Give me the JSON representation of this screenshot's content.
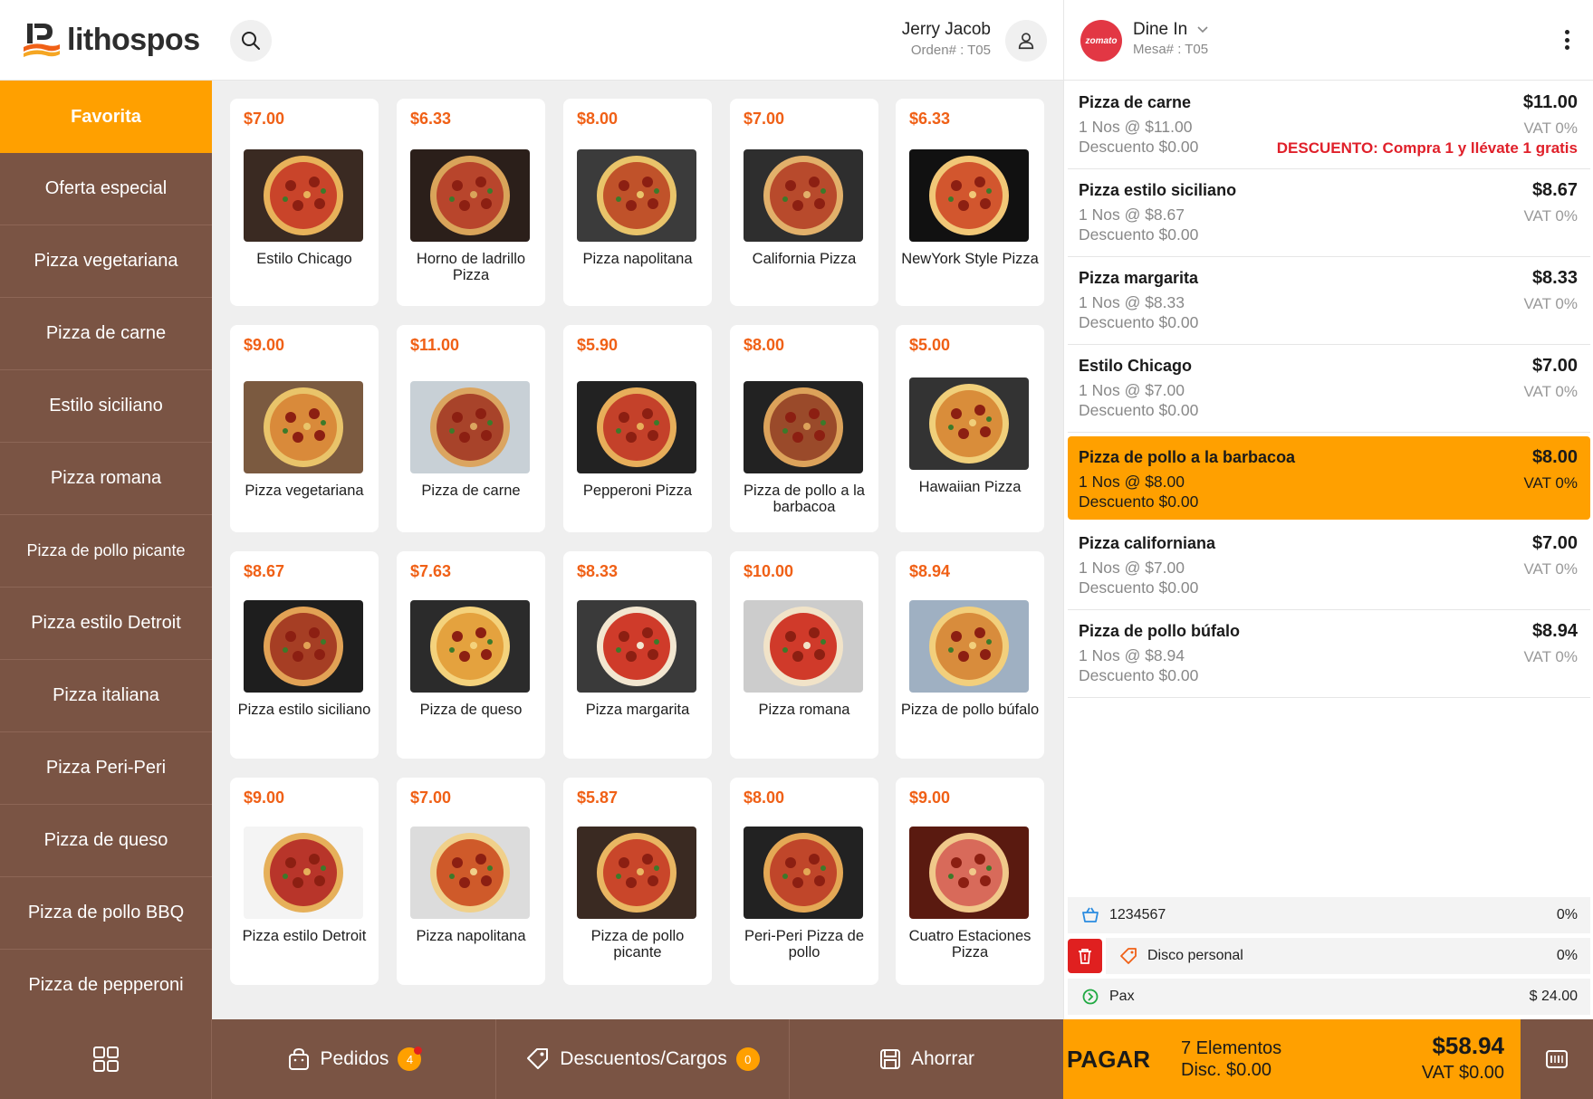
{
  "brand": {
    "name": "lithospos"
  },
  "header": {
    "user_name": "Jerry Jacob",
    "order_number": "Orden# : T05"
  },
  "categories": [
    "Favorita",
    "Oferta especial",
    "Pizza vegetariana",
    "Pizza de carne",
    "Estilo siciliano",
    "Pizza romana",
    "Pizza de pollo picante",
    "Pizza estilo Detroit",
    "Pizza italiana",
    "Pizza Peri-Peri",
    "Pizza de queso",
    "Pizza de pollo BBQ",
    "Pizza de pepperoni"
  ],
  "active_category": "Favorita",
  "products": [
    {
      "price": "$7.00",
      "name": "Estilo Chicago"
    },
    {
      "price": "$6.33",
      "name": "Horno de ladrillo Pizza"
    },
    {
      "price": "$8.00",
      "name": "Pizza napolitana"
    },
    {
      "price": "$7.00",
      "name": "California Pizza"
    },
    {
      "price": "$6.33",
      "name": "NewYork Style Pizza"
    },
    {
      "price": "$9.00",
      "name": "Pizza vegetariana"
    },
    {
      "price": "$11.00",
      "name": "Pizza de carne"
    },
    {
      "price": "$5.90",
      "name": "Pepperoni Pizza"
    },
    {
      "price": "$8.00",
      "name": "Pizza de pollo a la barbacoa"
    },
    {
      "price": "$5.00",
      "name": "Hawaiian Pizza"
    },
    {
      "price": "$8.67",
      "name": "Pizza estilo siciliano"
    },
    {
      "price": "$7.63",
      "name": "Pizza de queso"
    },
    {
      "price": "$8.33",
      "name": "Pizza margarita"
    },
    {
      "price": "$10.00",
      "name": "Pizza romana"
    },
    {
      "price": "$8.94",
      "name": "Pizza de pollo búfalo"
    },
    {
      "price": "$9.00",
      "name": "Pizza estilo Detroit"
    },
    {
      "price": "$7.00",
      "name": "Pizza napolitana"
    },
    {
      "price": "$5.87",
      "name": "Pizza de pollo picante"
    },
    {
      "price": "$8.00",
      "name": "Peri-Peri Pizza de pollo"
    },
    {
      "price": "$9.00",
      "name": "Cuatro Estaciones Pizza"
    }
  ],
  "bottom_bar": {
    "orders_label": "Pedidos",
    "orders_count": "4",
    "discounts_label": "Descuentos/Cargos",
    "discounts_count": "0",
    "save_label": "Ahorrar"
  },
  "order_panel": {
    "partner": "zomato",
    "order_type": "Dine In",
    "table": "Mesa# : T05",
    "items": [
      {
        "name": "Pizza de carne",
        "qty": "1 Nos @ $11.00",
        "discount": "Descuento $0.00",
        "price": "$11.00",
        "vat": "VAT 0%",
        "promo": "DESCUENTO: Compra 1 y llévate 1 gratis",
        "selected": false
      },
      {
        "name": "Pizza estilo siciliano",
        "qty": "1 Nos @ $8.67",
        "discount": "Descuento $0.00",
        "price": "$8.67",
        "vat": "VAT 0%",
        "promo": "",
        "selected": false
      },
      {
        "name": "Pizza margarita",
        "qty": "1 Nos @ $8.33",
        "discount": "Descuento $0.00",
        "price": "$8.33",
        "vat": "VAT 0%",
        "promo": "",
        "selected": false
      },
      {
        "name": "Estilo Chicago",
        "qty": "1 Nos @ $7.00",
        "discount": "Descuento $0.00",
        "price": "$7.00",
        "vat": "VAT 0%",
        "promo": "",
        "selected": false
      },
      {
        "name": "Pizza de pollo a la barbacoa",
        "qty": "1 Nos @ $8.00",
        "discount": "Descuento $0.00",
        "price": "$8.00",
        "vat": "VAT 0%",
        "promo": "",
        "selected": true
      },
      {
        "name": "Pizza californiana",
        "qty": "1 Nos @ $7.00",
        "discount": "Descuento $0.00",
        "price": "$7.00",
        "vat": "VAT 0%",
        "promo": "",
        "selected": false
      },
      {
        "name": "Pizza de pollo búfalo",
        "qty": "1 Nos @ $8.94",
        "discount": "Descuento $0.00",
        "price": "$8.94",
        "vat": "VAT 0%",
        "promo": "",
        "selected": false
      }
    ],
    "summary": {
      "customer_label": "1234567",
      "customer_value": "0%",
      "discount_label": "Disco personal",
      "discount_value": "0%",
      "pax_label": "Pax",
      "pax_value": "$ 24.00"
    },
    "pay": {
      "label": "PAGAR",
      "items": "7 Elementos",
      "disc": "Disc. $0.00",
      "total": "$58.94",
      "vat": "VAT $0.00"
    }
  },
  "colors": {
    "accent": "#ffa000",
    "sidebar": "#7a5444",
    "price": "#f06016",
    "promo": "#e0202a"
  }
}
